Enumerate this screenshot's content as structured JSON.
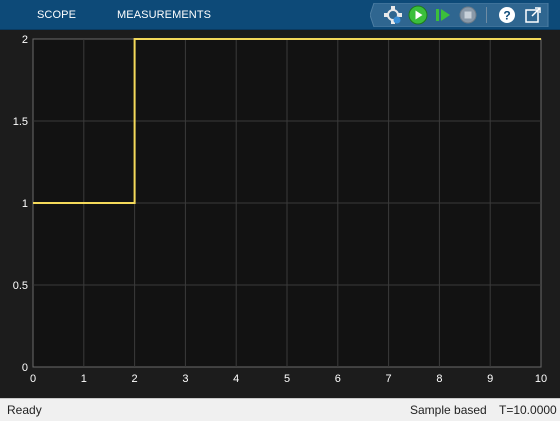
{
  "toolbar": {
    "tabs": [
      {
        "label": "SCOPE"
      },
      {
        "label": "MEASUREMENTS"
      }
    ],
    "icons": [
      "highlight-blocks-icon",
      "run-icon",
      "step-forward-icon",
      "stop-icon",
      "help-icon",
      "undock-icon"
    ],
    "colors": {
      "background": "#0d4a78",
      "run": "#3bbf3b",
      "stop_disabled": "#8a99a8"
    }
  },
  "chart_data": {
    "type": "line",
    "step": true,
    "series": [
      {
        "x": [
          0,
          2,
          2,
          10
        ],
        "y": [
          1,
          1,
          2,
          2
        ],
        "color": "#f4d95a"
      }
    ],
    "xlim": [
      0,
      10
    ],
    "ylim": [
      0,
      2
    ],
    "xticks": [
      "0",
      "1",
      "2",
      "3",
      "4",
      "5",
      "6",
      "7",
      "8",
      "9",
      "10"
    ],
    "yticks": [
      "0",
      "0.5",
      "1",
      "1.5",
      "2"
    ],
    "grid": true,
    "colors": {
      "axes_background": "#121212",
      "figure_background": "#1c1c1c",
      "grid": "#3a3a3a",
      "tick_text": "#ffffff"
    }
  },
  "status": {
    "state": "Ready",
    "mode": "Sample based",
    "time": "T=10.0000"
  }
}
